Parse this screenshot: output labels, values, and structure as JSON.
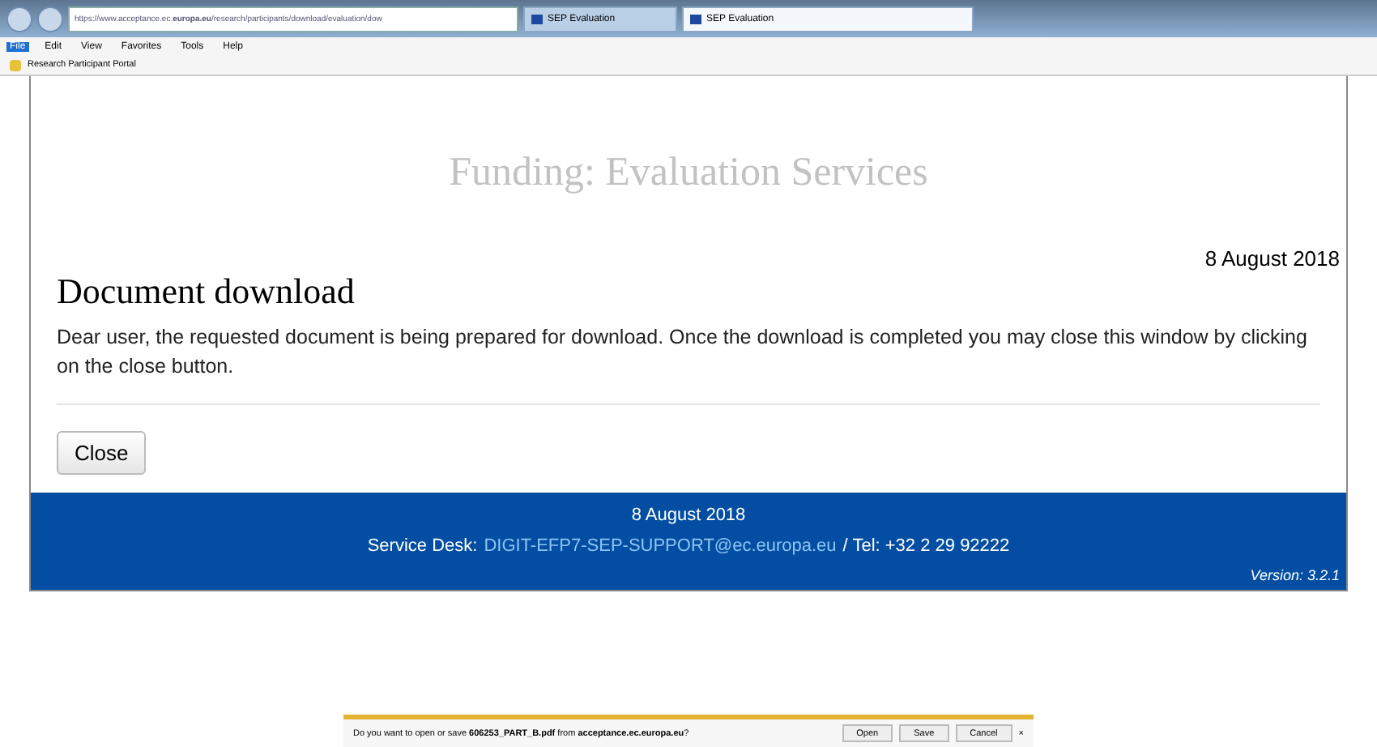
{
  "browser": {
    "address": "https://www.acceptance.ec.**europa.eu**/research/participants/download/evaluation/dow",
    "tabs": [
      {
        "title": "SEP Evaluation",
        "selected": false
      },
      {
        "title": "SEP Evaluation",
        "selected": true
      }
    ],
    "menu": [
      {
        "label": "File",
        "selected": true
      },
      {
        "label": "Edit",
        "selected": false
      },
      {
        "label": "View",
        "selected": false
      },
      {
        "label": "Favorites",
        "selected": false
      },
      {
        "label": "Tools",
        "selected": false
      },
      {
        "label": "Help",
        "selected": false
      }
    ],
    "favorites": [
      "Research Participant Portal"
    ]
  },
  "page": {
    "banner": "Funding: Evaluation Services",
    "date": "8 August 2018",
    "heading": "Document download",
    "message": "Dear user, the requested document is being prepared for download. Once the download is completed you may close this window by clicking on the close button.",
    "close_button": "Close"
  },
  "footer": {
    "date": "8 August 2018",
    "desk_label": "Service Desk:",
    "email": "DIGIT-EFP7-SEP-SUPPORT@ec.europa.eu",
    "tel": "/ Tel: +32 2 29 92222",
    "version": "Version: 3.2.1"
  },
  "download_bar": {
    "message": "Do you want to open or save **606253_PART_B.pdf** from **acceptance.ec.europa.eu**?",
    "buttons": [
      "Open",
      "Save",
      "Cancel"
    ],
    "close": "×"
  }
}
